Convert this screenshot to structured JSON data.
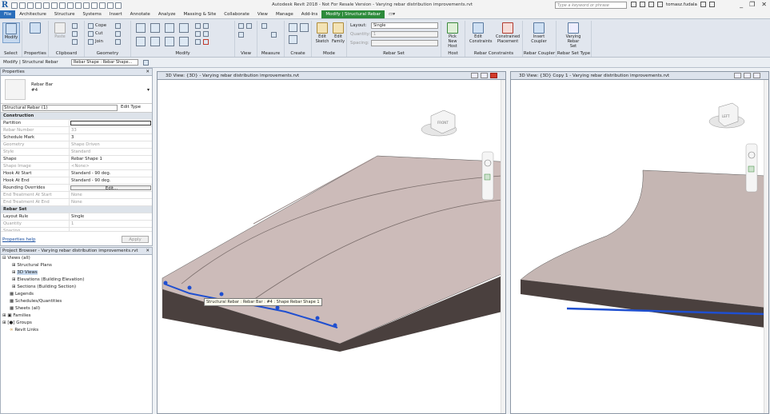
{
  "app": {
    "window_title": "Autodesk Revit 2018 - Not For Resale Version -  Varying rebar distribution improvements.rvt",
    "search_placeholder": "Type a keyword or phrase",
    "username": "tomasz.fudala"
  },
  "tabs": [
    "File",
    "Architecture",
    "Structure",
    "Systems",
    "Insert",
    "Annotate",
    "Analyze",
    "Massing & Site",
    "Collaborate",
    "View",
    "Manage",
    "Add-Ins",
    "Modify | Structural Rebar"
  ],
  "ribbon": {
    "panels": {
      "select": "Select",
      "properties": "Properties",
      "clipboard": "Clipboard",
      "geometry": "Geometry",
      "modify": "Modify",
      "view": "View",
      "measure": "Measure",
      "create": "Create",
      "mode": "Mode",
      "rebar_set": "Rebar Set",
      "host": "Host",
      "rebar_constraints": "Rebar Constraints",
      "rebar_coupler": "Rebar Coupler",
      "rebar_set_type": "Rebar Set Type"
    },
    "buttons": {
      "modify": "Modify",
      "paste": "Paste",
      "cope": "Cope",
      "cut": "Cut",
      "join": "Join",
      "edit_sketch": "Edit Sketch",
      "edit_family": "Edit Family",
      "pick_new_host": "Pick New Host",
      "edit_constraints": "Edit Constraints",
      "constrained_placement": "Constrained Placement",
      "insert_coupler": "Insert Coupler",
      "varying_rebar_set": "Varying Rebar Set"
    },
    "layout_label": "Layout:",
    "layout_value": "Single",
    "quantity_label": "Quantity:",
    "quantity_value": "1",
    "spacing_label": "Spacing:"
  },
  "optbar": {
    "context": "Modify | Structural Rebar",
    "shape_select": "Rebar Shape : Rebar Shape..."
  },
  "properties": {
    "title": "Properties",
    "type_name": "Rebar Bar",
    "type_sub": "#4",
    "filter": "Structural Rebar (1)",
    "edit_type": "Edit Type",
    "rows": [
      {
        "k": "Construction",
        "v": "",
        "group": true
      },
      {
        "k": "Partition",
        "v": "",
        "grey": false
      },
      {
        "k": "Rebar Number",
        "v": "33",
        "grey": true
      },
      {
        "k": "Schedule Mark",
        "v": "3",
        "grey": false
      },
      {
        "k": "Geometry",
        "v": "Shape Driven",
        "grey": true
      },
      {
        "k": "Style",
        "v": "Standard",
        "grey": true
      },
      {
        "k": "Shape",
        "v": "Rebar Shape 1",
        "grey": false
      },
      {
        "k": "Shape Image",
        "v": "<None>",
        "grey": true
      },
      {
        "k": "Hook At Start",
        "v": "Standard - 90 deg.",
        "grey": false
      },
      {
        "k": "Hook At End",
        "v": "Standard - 90 deg.",
        "grey": false
      },
      {
        "k": "Rounding Overrides",
        "v": "Edit...",
        "grey": false
      },
      {
        "k": "End Treatment At Start",
        "v": "None",
        "grey": true
      },
      {
        "k": "End Treatment At End",
        "v": "None",
        "grey": true
      },
      {
        "k": "Rebar Set",
        "v": "",
        "group": true
      },
      {
        "k": "Layout Rule",
        "v": "Single",
        "grey": false
      },
      {
        "k": "Quantity",
        "v": "1",
        "grey": true
      },
      {
        "k": "Spacing",
        "v": "",
        "grey": true
      }
    ],
    "help": "Properties help",
    "apply": "Apply"
  },
  "browser": {
    "title": "Project Browser - Varying rebar distribution improvements.rvt",
    "items": [
      {
        "label": "Views (all)",
        "level": 0,
        "hl": false
      },
      {
        "label": "Structural Plans",
        "level": 1,
        "hl": false
      },
      {
        "label": "3D Views",
        "level": 1,
        "hl": true
      },
      {
        "label": "Elevations (Building Elevation)",
        "level": 1,
        "hl": false
      },
      {
        "label": "Sections (Building Section)",
        "level": 1,
        "hl": false
      },
      {
        "label": "Legends",
        "level": 0,
        "hl": false
      },
      {
        "label": "Schedules/Quantities",
        "level": 0,
        "hl": false
      },
      {
        "label": "Sheets (all)",
        "level": 0,
        "hl": false
      },
      {
        "label": "Families",
        "level": 0,
        "hl": false
      },
      {
        "label": "Groups",
        "level": 0,
        "hl": false
      },
      {
        "label": "Revit Links",
        "level": 0,
        "hl": false
      }
    ]
  },
  "views": {
    "left_title": "3D View: {3D} - Varying rebar distribution improvements.rvt",
    "right_title": "3D View: {3D} Copy 1 - Varying rebar distribution improvements.rvt",
    "left_cube": "FRONT",
    "right_cube": "LEFT",
    "tooltip": "Structural Rebar : Rebar Bar : #4 : Shape Rebar Shape 1"
  },
  "colors": {
    "file_tab": "#2a6ebb",
    "context_tab": "#2c8a3a",
    "rebar_highlight": "#1f4fd0",
    "slab_top": "#cdbcba",
    "slab_side": "#4a403e"
  }
}
